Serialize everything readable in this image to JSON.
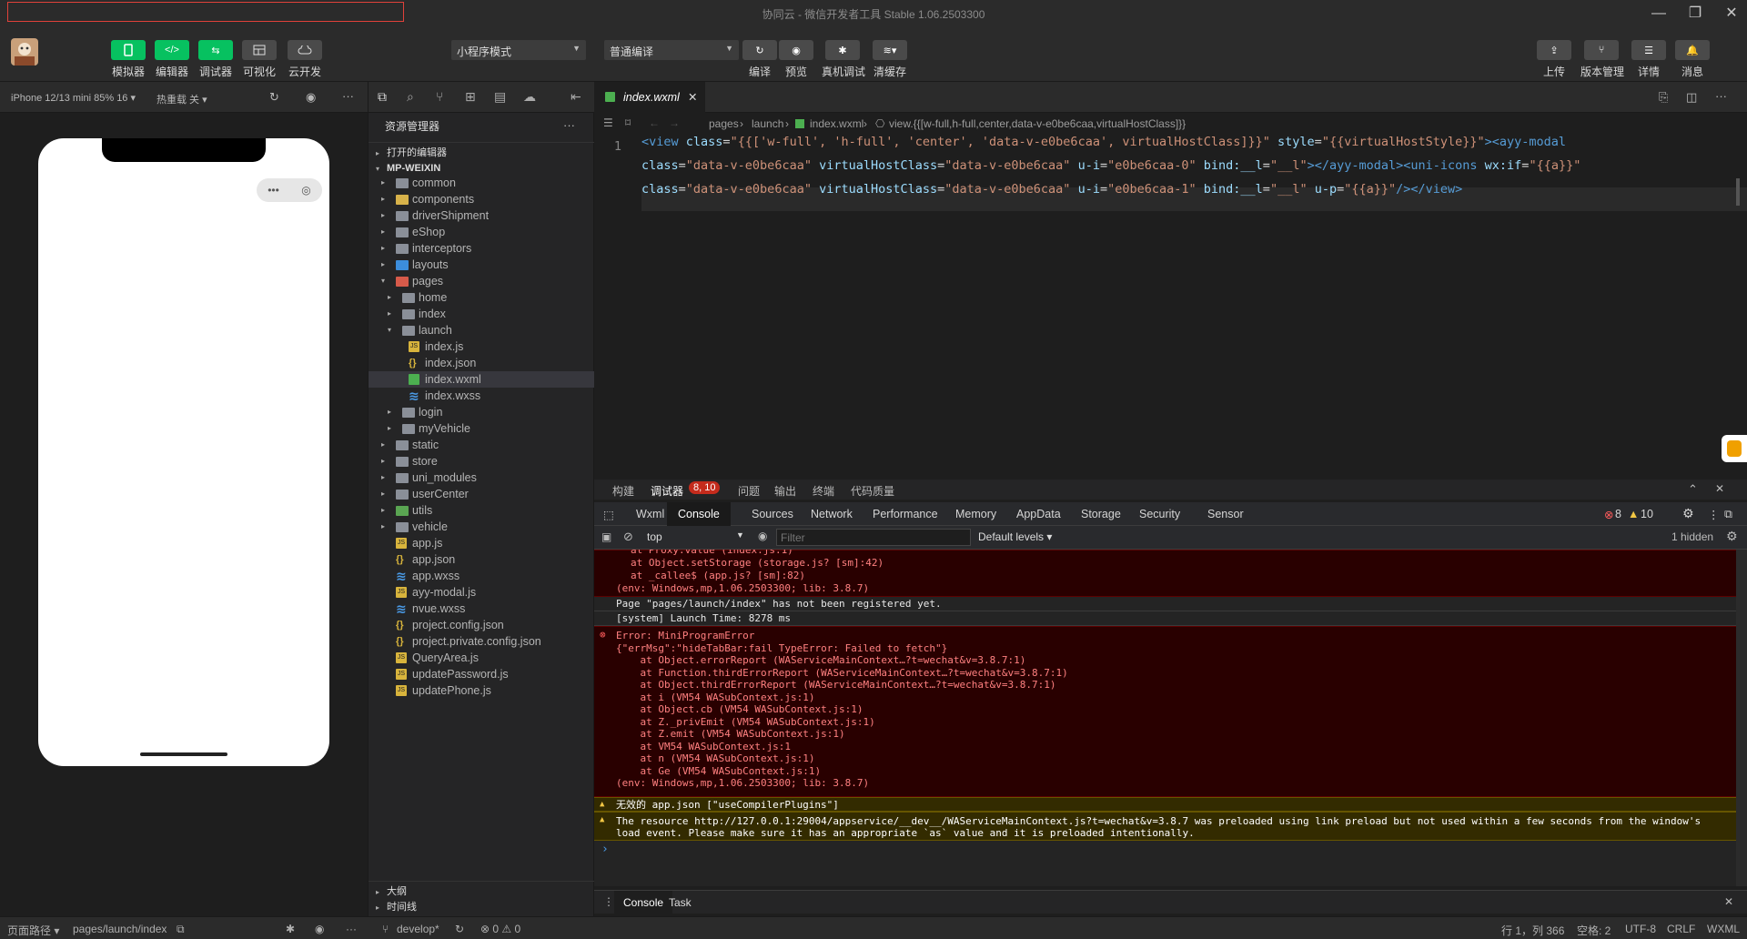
{
  "window": {
    "title": "协同云 - 微信开发者工具 Stable 1.06.2503300"
  },
  "toolbar": {
    "simulator": "模拟器",
    "editor": "编辑器",
    "debugger": "调试器",
    "visual": "可视化",
    "cloud": "云开发",
    "mode_select": "小程序模式",
    "compile_select": "普通编译",
    "compile": "编译",
    "preview": "预览",
    "remote_debug": "真机调试",
    "clear_cache": "清缓存",
    "upload": "上传",
    "version": "版本管理",
    "details": "详情",
    "messages": "消息"
  },
  "simulator": {
    "device": "iPhone 12/13 mini 85% 16 ▾",
    "hot_reload": "热重载 关 ▾"
  },
  "explorer": {
    "title": "资源管理器",
    "open_editors": "打开的编辑器",
    "project": "MP-WEIXIN",
    "outline": "大纲",
    "timeline": "时间线",
    "items": [
      {
        "label": "common",
        "depth": 1,
        "type": "folder",
        "twisty": "▸"
      },
      {
        "label": "components",
        "depth": 1,
        "type": "folder-y",
        "twisty": "▸"
      },
      {
        "label": "driverShipment",
        "depth": 1,
        "type": "folder",
        "twisty": "▸"
      },
      {
        "label": "eShop",
        "depth": 1,
        "type": "folder",
        "twisty": "▸"
      },
      {
        "label": "interceptors",
        "depth": 1,
        "type": "folder",
        "twisty": "▸"
      },
      {
        "label": "layouts",
        "depth": 1,
        "type": "folder-b",
        "twisty": "▸"
      },
      {
        "label": "pages",
        "depth": 1,
        "type": "folder-r",
        "twisty": "▾"
      },
      {
        "label": "home",
        "depth": 2,
        "type": "folder",
        "twisty": "▸"
      },
      {
        "label": "index",
        "depth": 2,
        "type": "folder",
        "twisty": "▸"
      },
      {
        "label": "launch",
        "depth": 2,
        "type": "folder",
        "twisty": "▾"
      },
      {
        "label": "index.js",
        "depth": 3,
        "type": "js",
        "twisty": ""
      },
      {
        "label": "index.json",
        "depth": 3,
        "type": "json",
        "twisty": ""
      },
      {
        "label": "index.wxml",
        "depth": 3,
        "type": "wxml",
        "twisty": "",
        "selected": true
      },
      {
        "label": "index.wxss",
        "depth": 3,
        "type": "wxss",
        "twisty": ""
      },
      {
        "label": "login",
        "depth": 2,
        "type": "folder",
        "twisty": "▸"
      },
      {
        "label": "myVehicle",
        "depth": 2,
        "type": "folder",
        "twisty": "▸"
      },
      {
        "label": "static",
        "depth": 1,
        "type": "folder",
        "twisty": "▸"
      },
      {
        "label": "store",
        "depth": 1,
        "type": "folder",
        "twisty": "▸"
      },
      {
        "label": "uni_modules",
        "depth": 1,
        "type": "folder",
        "twisty": "▸"
      },
      {
        "label": "userCenter",
        "depth": 1,
        "type": "folder",
        "twisty": "▸"
      },
      {
        "label": "utils",
        "depth": 1,
        "type": "folder-g",
        "twisty": "▸"
      },
      {
        "label": "vehicle",
        "depth": 1,
        "type": "folder",
        "twisty": "▸"
      },
      {
        "label": "app.js",
        "depth": 1,
        "type": "js",
        "twisty": ""
      },
      {
        "label": "app.json",
        "depth": 1,
        "type": "json",
        "twisty": ""
      },
      {
        "label": "app.wxss",
        "depth": 1,
        "type": "wxss",
        "twisty": ""
      },
      {
        "label": "ayy-modal.js",
        "depth": 1,
        "type": "js",
        "twisty": ""
      },
      {
        "label": "nvue.wxss",
        "depth": 1,
        "type": "wxss",
        "twisty": ""
      },
      {
        "label": "project.config.json",
        "depth": 1,
        "type": "json",
        "twisty": ""
      },
      {
        "label": "project.private.config.json",
        "depth": 1,
        "type": "json",
        "twisty": ""
      },
      {
        "label": "QueryArea.js",
        "depth": 1,
        "type": "js",
        "twisty": ""
      },
      {
        "label": "updatePassword.js",
        "depth": 1,
        "type": "js",
        "twisty": ""
      },
      {
        "label": "updatePhone.js",
        "depth": 1,
        "type": "js",
        "twisty": ""
      }
    ]
  },
  "editor": {
    "tab": "index.wxml",
    "breadcrumb": [
      "pages",
      "launch",
      "index.wxml",
      "view.{{[w-full,h-full,center,data-v-e0be6caa,virtualHostClass]}}"
    ],
    "line_number": "1",
    "lines": [
      [
        [
          "tk-tag",
          "<view"
        ],
        [
          "tk-attr",
          " class"
        ],
        [
          "tk-pun",
          "="
        ],
        [
          "tk-str",
          "\"{{['w-full', 'h-full', 'center', 'data-v-e0be6caa', virtualHostClass]}}\""
        ],
        [
          "tk-attr",
          " style"
        ],
        [
          "tk-pun",
          "="
        ],
        [
          "tk-str",
          "\"{{virtualHostStyle}}\""
        ],
        [
          "tk-tag",
          "><ayy-modal"
        ]
      ],
      [
        [
          "tk-attr",
          "class"
        ],
        [
          "tk-pun",
          "="
        ],
        [
          "tk-str",
          "\"data-v-e0be6caa\""
        ],
        [
          "tk-attr",
          " virtualHostClass"
        ],
        [
          "tk-pun",
          "="
        ],
        [
          "tk-str",
          "\"data-v-e0be6caa\""
        ],
        [
          "tk-attr",
          " u-i"
        ],
        [
          "tk-pun",
          "="
        ],
        [
          "tk-str",
          "\"e0be6caa-0\""
        ],
        [
          "tk-attr",
          " bind:__l"
        ],
        [
          "tk-pun",
          "="
        ],
        [
          "tk-str",
          "\"__l\""
        ],
        [
          "tk-tag",
          "></ayy-modal><uni-icons"
        ],
        [
          "tk-attr",
          " wx:if"
        ],
        [
          "tk-pun",
          "="
        ],
        [
          "tk-str",
          "\"{{a}}\""
        ]
      ],
      [
        [
          "tk-attr",
          "class"
        ],
        [
          "tk-pun",
          "="
        ],
        [
          "tk-str",
          "\"data-v-e0be6caa\""
        ],
        [
          "tk-attr",
          " virtualHostClass"
        ],
        [
          "tk-pun",
          "="
        ],
        [
          "tk-str",
          "\"data-v-e0be6caa\""
        ],
        [
          "tk-attr",
          " u-i"
        ],
        [
          "tk-pun",
          "="
        ],
        [
          "tk-str",
          "\"e0be6caa-1\""
        ],
        [
          "tk-attr",
          " bind:__l"
        ],
        [
          "tk-pun",
          "="
        ],
        [
          "tk-str",
          "\"__l\""
        ],
        [
          "tk-attr",
          " u-p"
        ],
        [
          "tk-pun",
          "="
        ],
        [
          "tk-str",
          "\"{{a}}\""
        ],
        [
          "tk-tag",
          "/></view>"
        ]
      ]
    ]
  },
  "debug_panel": {
    "tabs": [
      "构建",
      "调试器",
      "问题",
      "输出",
      "终端",
      "代码质量"
    ],
    "debugger_badge": "8, 10",
    "devtools_tabs": [
      "Wxml",
      "Console",
      "Sources",
      "Network",
      "Performance",
      "Memory",
      "AppData",
      "Storage",
      "Security",
      "Sensor"
    ],
    "error_count": "8",
    "warning_count": "10",
    "context": "top",
    "filter_placeholder": "Filter",
    "levels": "Default levels ▾",
    "hidden": "1 hidden",
    "console": {
      "block1": [
        "at Proxy.value (index.js:1)",
        "at Object.setStorage (storage.js? [sm]:42)",
        "at _callee$ (app.js? [sm]:82)",
        "(env: Windows,mp,1.06.2503300; lib: 3.8.7)"
      ],
      "info1": "Page \"pages/launch/index\" has not been registered yet.",
      "info2": "[system] Launch Time: 8278 ms",
      "error2": [
        "Error: MiniProgramError",
        "{\"errMsg\":\"hideTabBar:fail TypeError: Failed to fetch\"}",
        "    at Object.errorReport (WAServiceMainContext…?t=wechat&v=3.8.7:1)",
        "    at Function.thirdErrorReport (WAServiceMainContext…?t=wechat&v=3.8.7:1)",
        "    at Object.thirdErrorReport (WAServiceMainContext…?t=wechat&v=3.8.7:1)",
        "    at i (VM54 WASubContext.js:1)",
        "    at Object.cb (VM54 WASubContext.js:1)",
        "    at Z._privEmit (VM54 WASubContext.js:1)",
        "    at Z.emit (VM54 WASubContext.js:1)",
        "    at VM54 WASubContext.js:1",
        "    at n (VM54 WASubContext.js:1)",
        "    at Ge (VM54 WASubContext.js:1)",
        "(env: Windows,mp,1.06.2503300; lib: 3.8.7)"
      ],
      "warn1": "无效的 app.json [\"useCompilerPlugins\"]",
      "warn2": [
        "The resource http://127.0.0.1:29004/appservice/__dev__/WAServiceMainContext.js?t=wechat&v=3.8.7 was preloaded using link preload but not used within a few seconds from the window's",
        "load event. Please make sure it has an appropriate `as` value and it is preloaded intentionally."
      ],
      "prompt": "›"
    },
    "bottom_tabs": [
      "Console",
      "Task"
    ]
  },
  "statusbar": {
    "page_path_label": "页面路径 ▾",
    "page_path": "pages/launch/index",
    "branch": "develop*",
    "problems": "⊗ 0 ⚠ 0",
    "cursor": "行 1，列 366",
    "spaces": "空格: 2",
    "encoding": "UTF-8",
    "eol": "CRLF",
    "language": "WXML"
  },
  "colors": {
    "accent_green": "#07c160",
    "error_bg": "#290000",
    "warn_bg": "#332b00"
  }
}
